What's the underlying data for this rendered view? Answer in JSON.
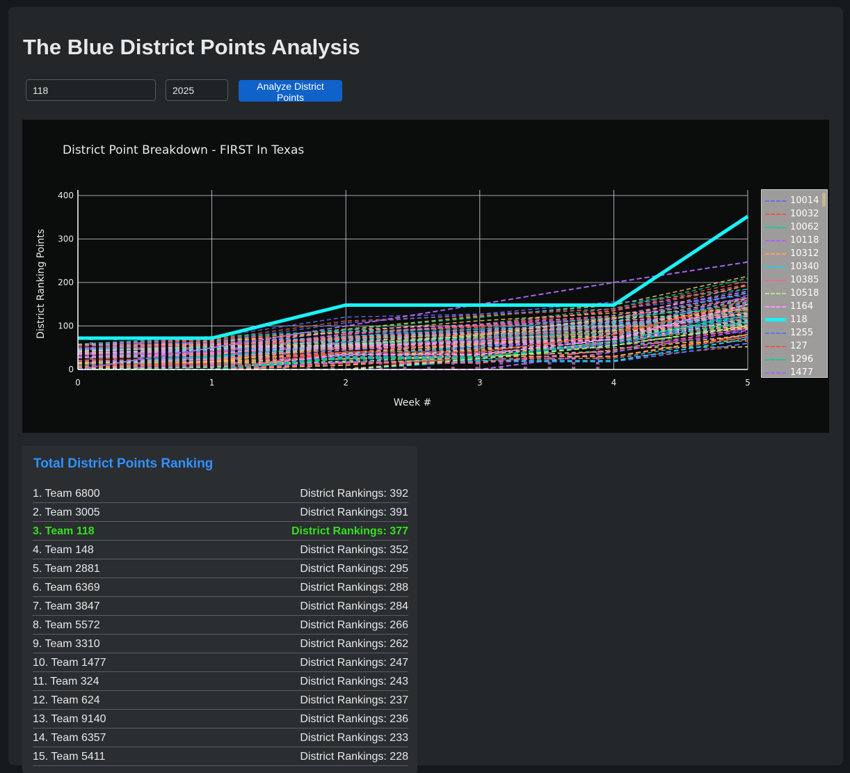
{
  "page": {
    "title": "The Blue District Points Analysis"
  },
  "controls": {
    "team_value": "118",
    "year_value": "2025",
    "analyze_label": "Analyze District Points"
  },
  "chart_data": {
    "type": "line",
    "title": "District Point Breakdown - FIRST In Texas",
    "xlabel": "Week #",
    "ylabel": "District Ranking Points",
    "xlim": [
      0,
      5
    ],
    "ylim": [
      0,
      400
    ],
    "x_ticks": [
      "0",
      "1",
      "2",
      "3",
      "4",
      "5"
    ],
    "y_ticks": [
      "0",
      "100",
      "200",
      "300",
      "400"
    ],
    "grid": true,
    "legend_placement": "right",
    "legend_entries": [
      "10014",
      "10032",
      "10062",
      "10118",
      "10312",
      "10340",
      "10385",
      "10518",
      "1164",
      "118",
      "1255",
      "127",
      "1296",
      "1477"
    ],
    "highlight_team": "118",
    "x": [
      0,
      1,
      2,
      3,
      4,
      5
    ],
    "series": [
      {
        "name": "118",
        "values": [
          72,
          72,
          148,
          148,
          148,
          352
        ],
        "color": "#19f3f7",
        "highlight": true
      },
      {
        "name": "10014",
        "values": [
          0,
          0,
          18,
          18,
          18,
          60
        ],
        "color": "#636efa"
      },
      {
        "name": "10032",
        "values": [
          0,
          0,
          0,
          30,
          30,
          75
        ],
        "color": "#ef553b"
      },
      {
        "name": "10062",
        "values": [
          0,
          0,
          25,
          25,
          60,
          110
        ],
        "color": "#00cc96"
      },
      {
        "name": "10118",
        "values": [
          0,
          0,
          0,
          0,
          40,
          90
        ],
        "color": "#ab63fa"
      },
      {
        "name": "10312",
        "values": [
          0,
          0,
          10,
          30,
          30,
          80
        ],
        "color": "#ffa15a"
      },
      {
        "name": "10340",
        "values": [
          0,
          0,
          0,
          20,
          20,
          70
        ],
        "color": "#19d3f3"
      },
      {
        "name": "10385",
        "values": [
          0,
          0,
          15,
          15,
          45,
          95
        ],
        "color": "#ff6692"
      },
      {
        "name": "10518",
        "values": [
          0,
          0,
          0,
          25,
          55,
          100
        ],
        "color": "#b6e880"
      },
      {
        "name": "1164",
        "values": [
          0,
          0,
          35,
          35,
          70,
          150
        ],
        "color": "#ff97ff"
      },
      {
        "name": "1255",
        "values": [
          0,
          0,
          30,
          30,
          60,
          120
        ],
        "color": "#636efa"
      },
      {
        "name": "127",
        "values": [
          0,
          0,
          40,
          40,
          80,
          160
        ],
        "color": "#ef553b"
      },
      {
        "name": "1296",
        "values": [
          0,
          0,
          28,
          28,
          65,
          125
        ],
        "color": "#00cc96"
      },
      {
        "name": "1477",
        "values": [
          0,
          50,
          100,
          150,
          200,
          247
        ],
        "color": "#ab63fa"
      }
    ]
  },
  "ranking": {
    "title": "Total District Points Ranking",
    "highlight_team": "118",
    "rows": [
      {
        "label": "1. Team 6800",
        "points": "District Rankings: 392"
      },
      {
        "label": "2. Team 3005",
        "points": "District Rankings: 391"
      },
      {
        "label": "3. Team 118",
        "points": "District Rankings: 377",
        "highlight": true
      },
      {
        "label": "4. Team 148",
        "points": "District Rankings: 352"
      },
      {
        "label": "5. Team 2881",
        "points": "District Rankings: 295"
      },
      {
        "label": "6. Team 6369",
        "points": "District Rankings: 288"
      },
      {
        "label": "7. Team 3847",
        "points": "District Rankings: 284"
      },
      {
        "label": "8. Team 5572",
        "points": "District Rankings: 266"
      },
      {
        "label": "9. Team 3310",
        "points": "District Rankings: 262"
      },
      {
        "label": "10. Team 1477",
        "points": "District Rankings: 247"
      },
      {
        "label": "11. Team 324",
        "points": "District Rankings: 243"
      },
      {
        "label": "12. Team 624",
        "points": "District Rankings: 237"
      },
      {
        "label": "13. Team 9140",
        "points": "District Rankings: 236"
      },
      {
        "label": "14. Team 6357",
        "points": "District Rankings: 233"
      },
      {
        "label": "15. Team 5411",
        "points": "District Rankings: 228"
      }
    ]
  }
}
